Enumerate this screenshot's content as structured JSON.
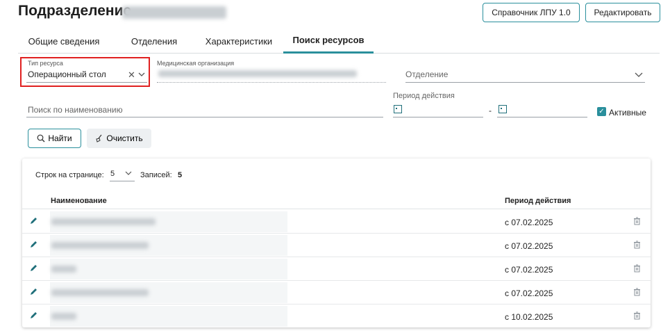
{
  "header": {
    "title": "Подразделение",
    "buttons": {
      "reference_label": "Справочник ЛПУ 1.0",
      "edit_label": "Редактировать"
    }
  },
  "tabs": [
    {
      "label": "Общие сведения",
      "active": false
    },
    {
      "label": "Отделения",
      "active": false
    },
    {
      "label": "Характеристики",
      "active": false
    },
    {
      "label": "Поиск ресурсов",
      "active": true
    }
  ],
  "filters": {
    "resource_type": {
      "label": "Тип ресурса",
      "value": "Операционный стол"
    },
    "med_org": {
      "label": "Медицинская организация"
    },
    "department": {
      "placeholder": "Отделение"
    },
    "name_search": {
      "placeholder": "Поиск по наименованию"
    },
    "period": {
      "label": "Период действия",
      "separator": "-"
    },
    "active": {
      "label": "Активные",
      "checked": true
    }
  },
  "actions": {
    "find_label": "Найти",
    "clear_label": "Очистить"
  },
  "table": {
    "rows_per_page_label": "Строк на странице:",
    "rows_per_page_value": "5",
    "records_label": "Записей:",
    "records_value": "5",
    "columns": {
      "name": "Наименование",
      "period": "Период действия"
    },
    "rows": [
      {
        "period": "с 07.02.2025"
      },
      {
        "period": "с 07.02.2025"
      },
      {
        "period": "с 07.02.2025"
      },
      {
        "period": "с 07.02.2025"
      },
      {
        "period": "с 10.02.2025"
      }
    ]
  },
  "colors": {
    "accent": "#2a8f9c",
    "highlight_border": "#e02020"
  },
  "icons": [
    "close-icon",
    "chevron-down-icon",
    "calendar-icon",
    "checkbox-checked-icon",
    "search-icon",
    "broom-icon",
    "pencil-icon",
    "trash-icon"
  ]
}
